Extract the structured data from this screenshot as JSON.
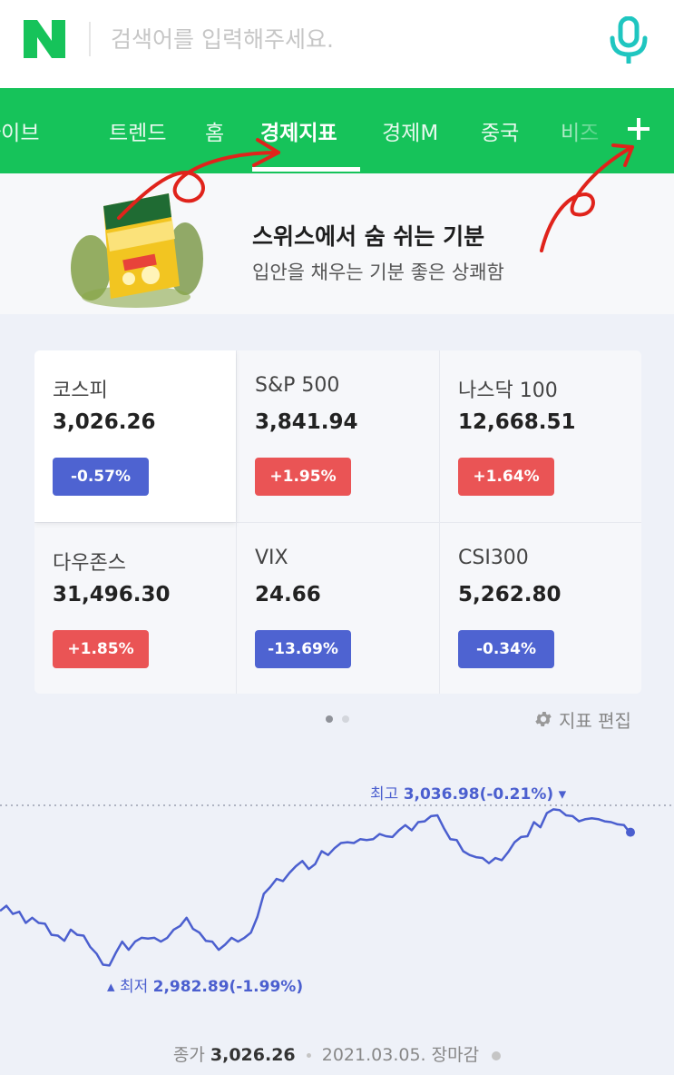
{
  "search": {
    "placeholder": "검색어를 입력해주세요."
  },
  "icons": {
    "logo": "naver-n-logo",
    "mic": "microphone-icon",
    "plus": "plus-icon",
    "gear": "gear-icon"
  },
  "colors": {
    "brand_green": "#16c35a",
    "down_blue": "#4e63d1",
    "up_red": "#ea5455",
    "chart_line": "#4b5fcf"
  },
  "tabs": [
    {
      "label": "라이브",
      "active": false
    },
    {
      "label": "트렌드",
      "active": false
    },
    {
      "label": "홈",
      "active": false
    },
    {
      "label": "경제지표",
      "active": true
    },
    {
      "label": "경제M",
      "active": false
    },
    {
      "label": "중국",
      "active": false
    },
    {
      "label": "비즈",
      "active": false
    }
  ],
  "ad": {
    "title": "스위스에서 숨 쉬는 기분",
    "subtitle": "입안을 채우는 기분 좋은 상쾌함"
  },
  "indices": [
    {
      "name": "코스피",
      "value": "3,026.26",
      "change": "-0.57%",
      "direction": "down"
    },
    {
      "name": "S&P 500",
      "value": "3,841.94",
      "change": "+1.95%",
      "direction": "up"
    },
    {
      "name": "나스닥 100",
      "value": "12,668.51",
      "change": "+1.64%",
      "direction": "up"
    },
    {
      "name": "다우존스",
      "value": "31,496.30",
      "change": "+1.85%",
      "direction": "up"
    },
    {
      "name": "VIX",
      "value": "24.66",
      "change": "-13.69%",
      "direction": "down"
    },
    {
      "name": "CSI300",
      "value": "5,262.80",
      "change": "-0.34%",
      "direction": "down"
    }
  ],
  "pager": {
    "pages": 2,
    "current": 1
  },
  "edit_label": "지표 편집",
  "chart_data": {
    "type": "line",
    "series": [
      {
        "values": [
          3002,
          3003,
          3001,
          3001,
          2998,
          2999,
          2998,
          2997,
          2994,
          2993,
          2992,
          2995,
          2994,
          2993,
          2990,
          2987,
          2984,
          2983,
          2988,
          2991,
          2989,
          2991,
          2993,
          2992,
          2993,
          2991,
          2993,
          2995,
          2997,
          2999,
          2996,
          2994,
          2992,
          2991,
          2989,
          2990,
          2993,
          2991,
          2993,
          2994,
          3000,
          3007,
          3010,
          3012,
          3012,
          3014,
          3017,
          3018,
          3016,
          3017,
          3022,
          3020,
          3023,
          3024,
          3025,
          3024,
          3026,
          3025,
          3026,
          3027,
          3027,
          3026,
          3029,
          3030,
          3029,
          3031,
          3032,
          3033,
          3034,
          3029,
          3026,
          3025,
          3022,
          3020,
          3020,
          3019,
          3018,
          3019,
          3019,
          3021,
          3025,
          3026,
          3027,
          3031,
          3030,
          3034,
          3036,
          3035,
          3034,
          3033,
          3032,
          3032,
          3033,
          3032,
          3032,
          3031,
          3031,
          3030,
          3028
        ]
      }
    ],
    "high_label": {
      "prefix": "최고",
      "value": "3,036.98(-0.21%)"
    },
    "low_label": {
      "prefix": "최저",
      "value": "2,982.89(-1.99%)"
    },
    "high": 3036.98,
    "low": 2982.89
  },
  "footer": {
    "prefix": "종가",
    "close": "3,026.26",
    "date": "2021.03.05.",
    "status": "장마감"
  }
}
